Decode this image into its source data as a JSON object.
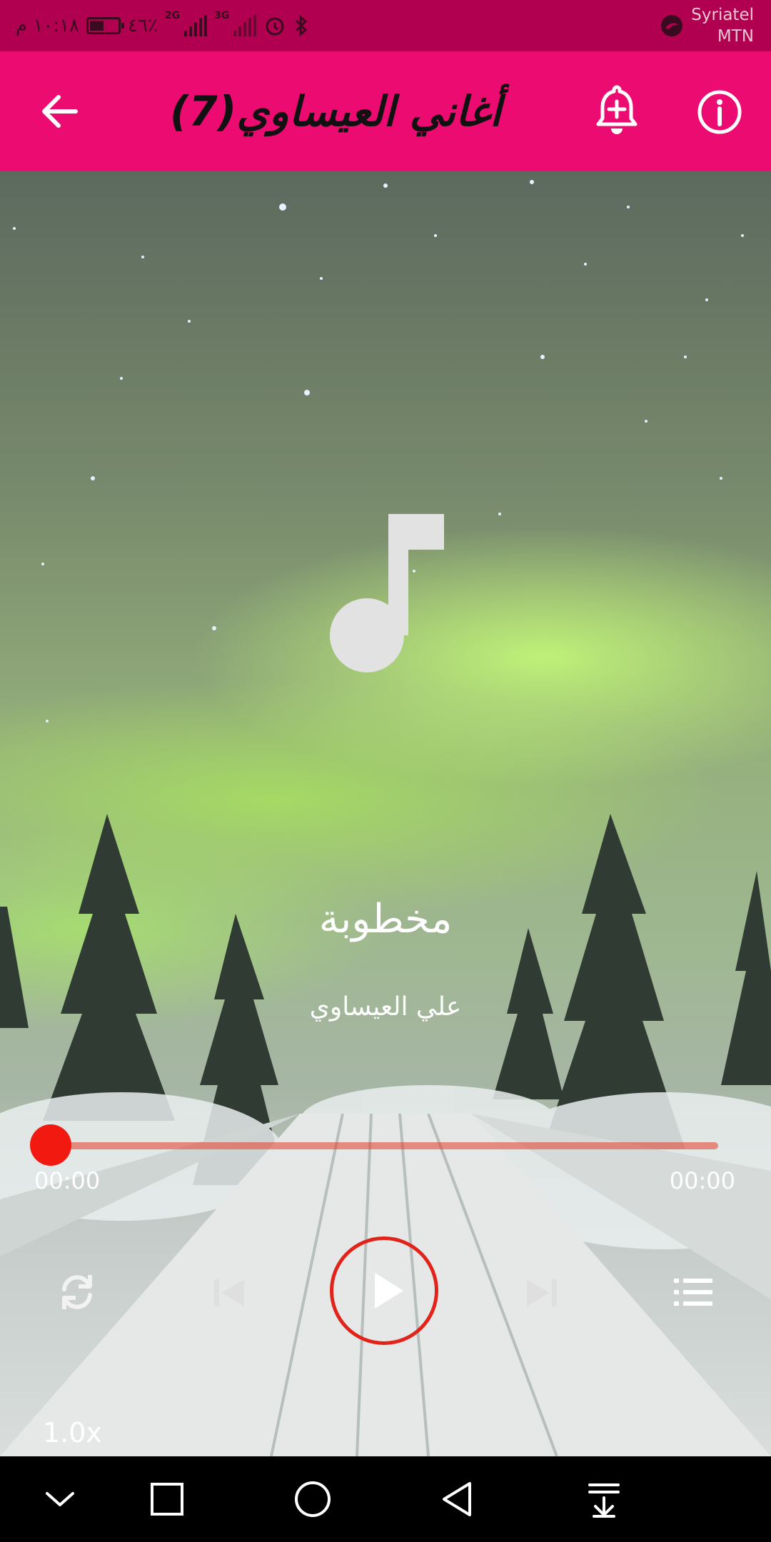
{
  "status_bar": {
    "time": "١٠:١٨ م",
    "battery_text": "٤٦٪",
    "battery_level": 0.46,
    "network_1": "2G",
    "network_2": "3G",
    "carrier_line1": "Syriatel",
    "carrier_line2": "MTN",
    "icons": [
      "battery-icon",
      "signal-icon",
      "alarm-clock-icon",
      "bluetooth-icon",
      "carrier-logo-icon"
    ]
  },
  "app_bar": {
    "title": "أغاني العيساوي(7)",
    "back_icon": "arrow-back-icon",
    "alarm_icon": "add-alarm-icon",
    "info_icon": "info-icon"
  },
  "player": {
    "song_title": "مخطوبة",
    "artist": "علي العيساوي",
    "elapsed": "00:00",
    "duration": "00:00",
    "progress": 0,
    "speed": "1.0x",
    "accent": "#e2231a",
    "controls": [
      "repeat-icon",
      "previous-icon",
      "play-icon",
      "next-icon",
      "playlist-icon"
    ]
  },
  "colors": {
    "status_bar": "#b0004f",
    "app_bar": "#ec0b70"
  },
  "nav_bar": {
    "icons": [
      "chevron-down-icon",
      "recents-square-icon",
      "home-circle-icon",
      "back-triangle-icon",
      "notification-pull-icon"
    ]
  }
}
